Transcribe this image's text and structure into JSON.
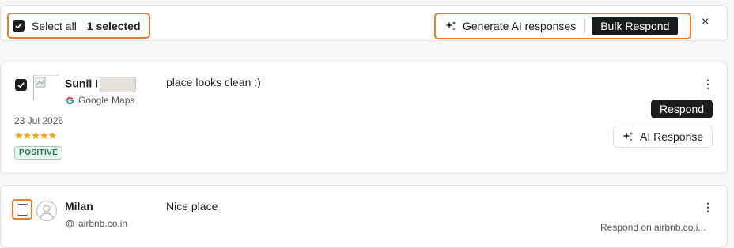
{
  "toolbar": {
    "select_all_label": "Select all",
    "selected_count": "1 selected",
    "generate_label": "Generate AI responses",
    "bulk_label": "Bulk Respond",
    "close_glyph": "×"
  },
  "reviews": [
    {
      "name": "Sunil I",
      "source": "Google Maps",
      "text": "place looks clean :)",
      "date": "23 Jul 2026",
      "stars": "★★★★★",
      "rating": 5,
      "sentiment": "POSITIVE",
      "respond_label": "Respond",
      "ai_label": "AI Response",
      "menu_glyph": "⋮",
      "checked": true
    },
    {
      "name": "Milan",
      "source": "airbnb.co.in",
      "text": "Nice place",
      "respond_on": "Respond on airbnb.co.i...",
      "menu_glyph": "⋮",
      "checked": false
    }
  ],
  "colors": {
    "highlight": "#ee7b2e",
    "accent_dark": "#1c1c1c",
    "star": "#f5a20a",
    "positive": "#24794a"
  }
}
